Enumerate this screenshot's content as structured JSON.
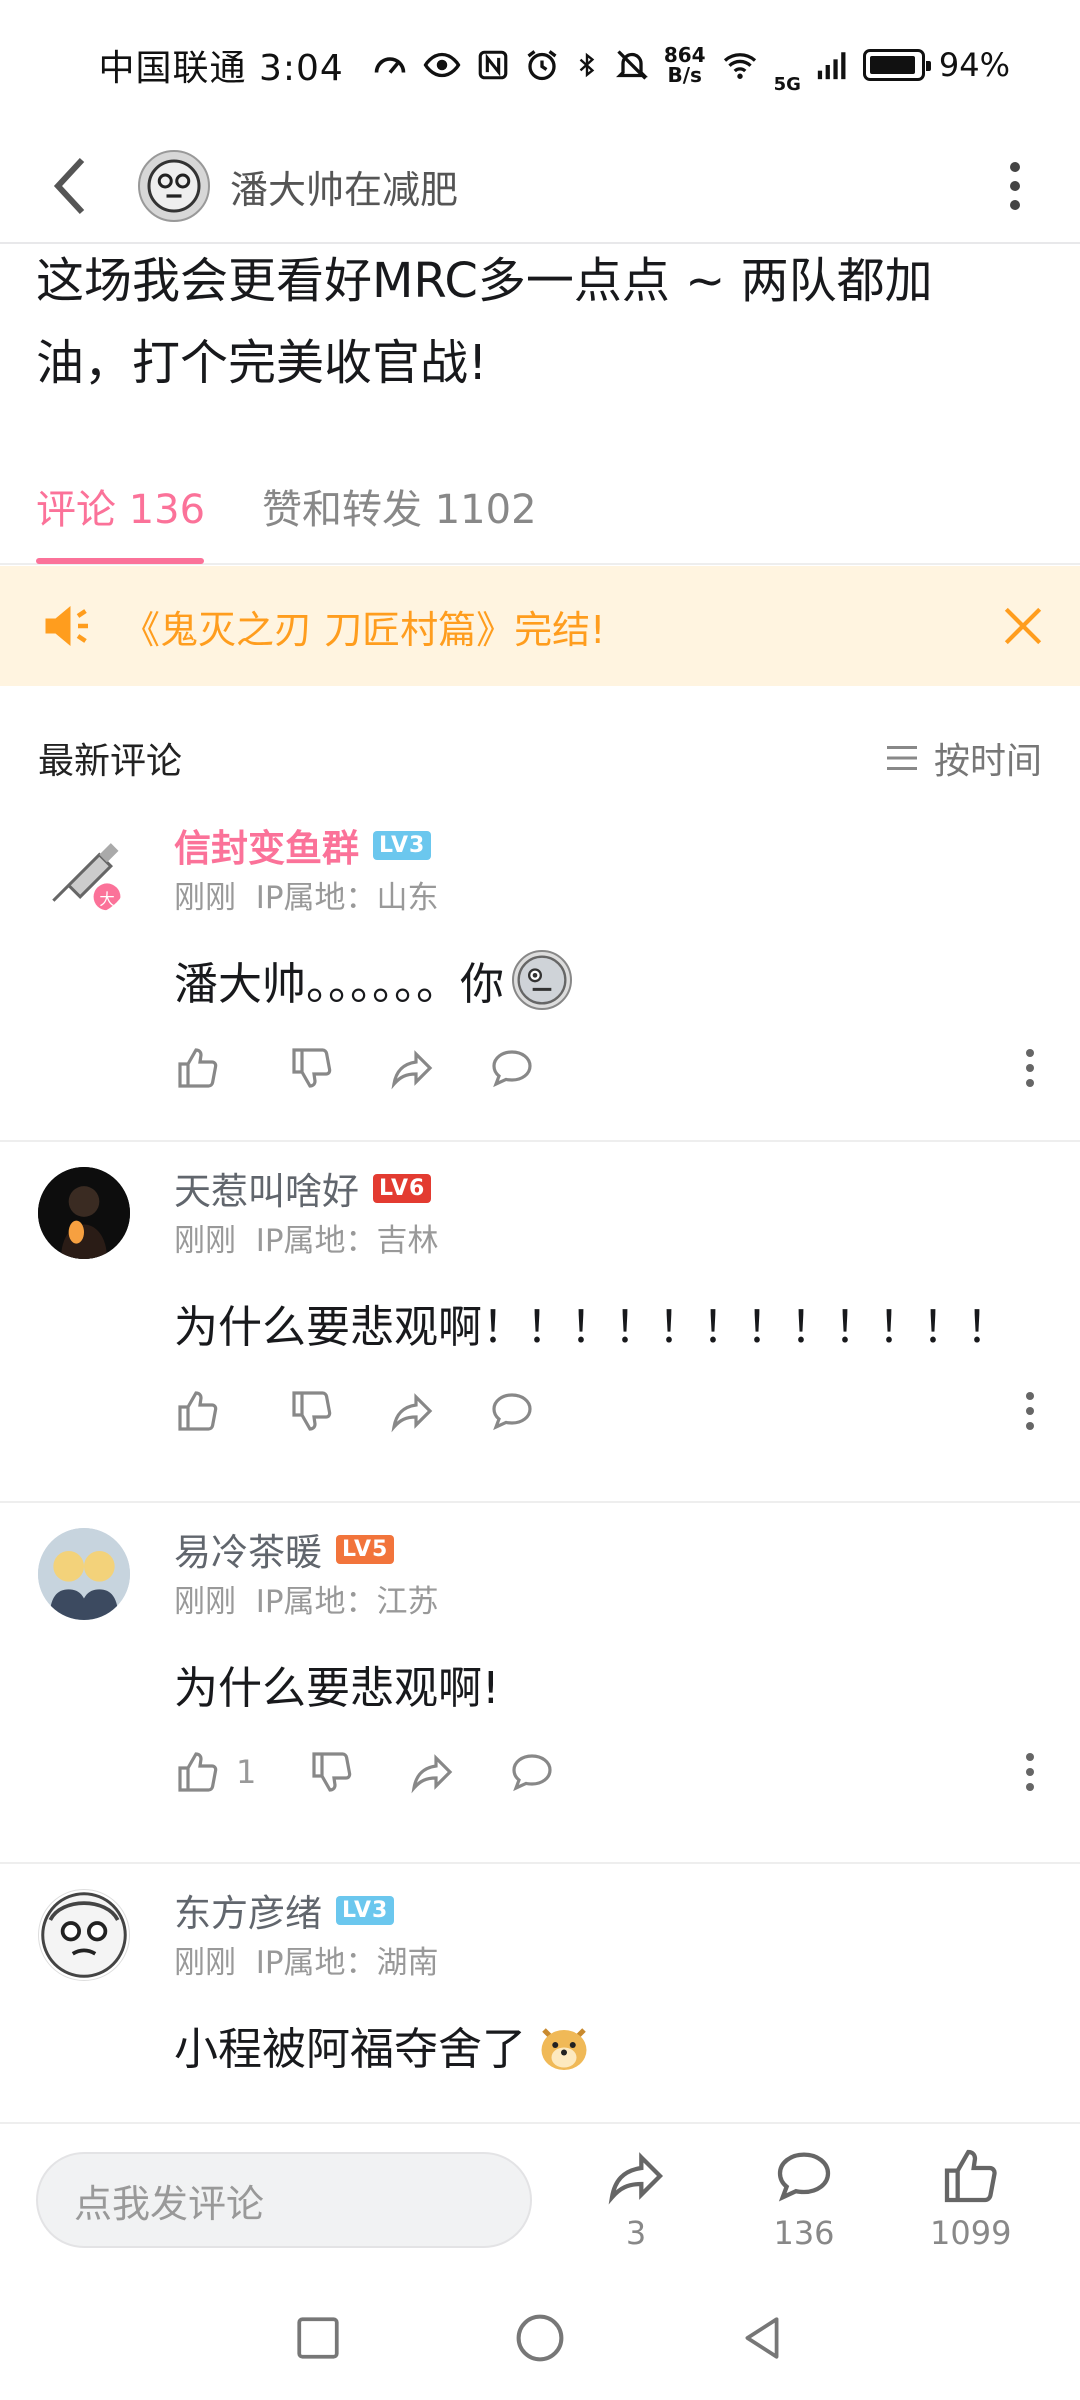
{
  "status_bar": {
    "carrier": "中国联通",
    "time": "3:04",
    "net_speed_value": "864",
    "net_speed_unit": "B/s",
    "signal_label": "5G",
    "battery_text": "94%",
    "battery_level": 0.94
  },
  "header": {
    "username": "潘大帅在减肥",
    "icons": [
      "back-arrow-icon",
      "more-vertical-icon"
    ]
  },
  "post": {
    "text_line1": "这场我会更看好MRC多一点点 ~ 两队都加",
    "text_line2": "油，打个完美收官战!"
  },
  "tabs": [
    {
      "label": "评论",
      "count": "136"
    },
    {
      "label": "赞和转发",
      "count": "1102"
    }
  ],
  "banner": {
    "text": "《鬼灭之刃 刀匠村篇》完结!"
  },
  "sort": {
    "section_label": "最新评论",
    "sort_label": "按时间"
  },
  "comments": [
    {
      "name": "信封变鱼群",
      "level": "LV3",
      "level_color": "#6bc7ee",
      "name_color": "#fb7299",
      "time": "刚刚",
      "ip": "IP属地：山东",
      "text": "潘大帅。。。。。。你",
      "likes": ""
    },
    {
      "name": "天惹叫啥好",
      "level": "LV6",
      "level_color": "#e33b31",
      "name_color": "#61666d",
      "time": "刚刚",
      "ip": "IP属地：吉林",
      "text": "为什么要悲观啊！！！！！！！！！！！！",
      "likes": ""
    },
    {
      "name": "易冷茶暖",
      "level": "LV5",
      "level_color": "#f2743b",
      "name_color": "#61666d",
      "time": "刚刚",
      "ip": "IP属地：江苏",
      "text": "为什么要悲观啊!",
      "likes": "1"
    },
    {
      "name": "东方彦绪",
      "level": "LV3",
      "level_color": "#6bc7ee",
      "name_color": "#61666d",
      "time": "刚刚",
      "ip": "IP属地：湖南",
      "text": "小程被阿福夺舍了",
      "likes": ""
    }
  ],
  "bottom_bar": {
    "input_placeholder": "点我发评论",
    "share_count": "3",
    "comment_count": "136",
    "like_count": "1099"
  },
  "colors": {
    "accent": "#fb7299",
    "banner_bg": "#fff4e0",
    "banner_text": "#ff9d1e"
  }
}
